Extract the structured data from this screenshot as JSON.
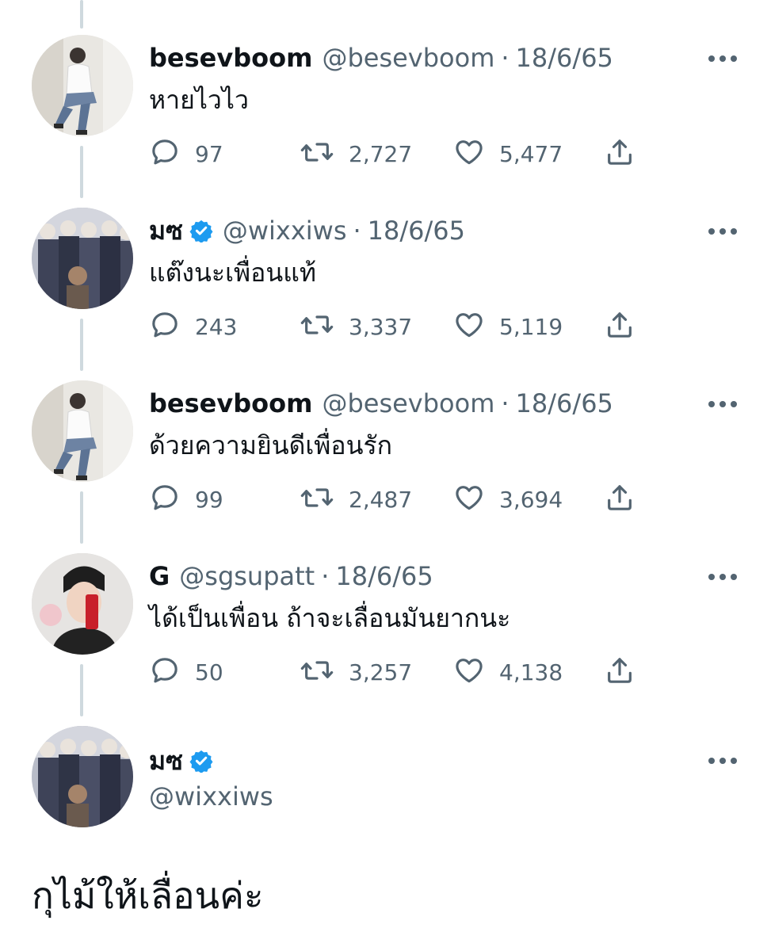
{
  "tweets": [
    {
      "name": "besevboom",
      "verified": false,
      "handle": "@besevboom",
      "separator": "·",
      "date": "18/6/65",
      "text": "หายไวไว",
      "replies": "97",
      "retweets": "2,727",
      "likes": "5,477"
    },
    {
      "name": "มซ",
      "verified": true,
      "handle": "@wixxiws",
      "separator": "·",
      "date": "18/6/65",
      "text": "แต๊งนะเพื่อนแท้",
      "replies": "243",
      "retweets": "3,337",
      "likes": "5,119"
    },
    {
      "name": "besevboom",
      "verified": false,
      "handle": "@besevboom",
      "separator": "·",
      "date": "18/6/65",
      "text": "ด้วยความยินดีเพื่อนรัก",
      "replies": "99",
      "retweets": "2,487",
      "likes": "3,694"
    },
    {
      "name": "G",
      "verified": false,
      "handle": "@sgsupatt",
      "separator": "·",
      "date": "18/6/65",
      "text": "ได้เป็นเพื่อน ถ้าจะเลื่อนมันยากนะ",
      "replies": "50",
      "retweets": "3,257",
      "likes": "4,138"
    }
  ],
  "final": {
    "name": "มซ",
    "verified": true,
    "handle": "@wixxiws",
    "text": "กุไม้ให้เลื่อนค่ะ"
  },
  "colors": {
    "text": "#0f1419",
    "secondary": "#536471",
    "verified": "#1d9bf0",
    "thread_line": "#cfd9de"
  },
  "icons": {
    "reply": "reply-icon",
    "retweet": "retweet-icon",
    "like": "heart-icon",
    "share": "share-icon",
    "more": "more-icon",
    "verified": "verified-badge-icon"
  }
}
